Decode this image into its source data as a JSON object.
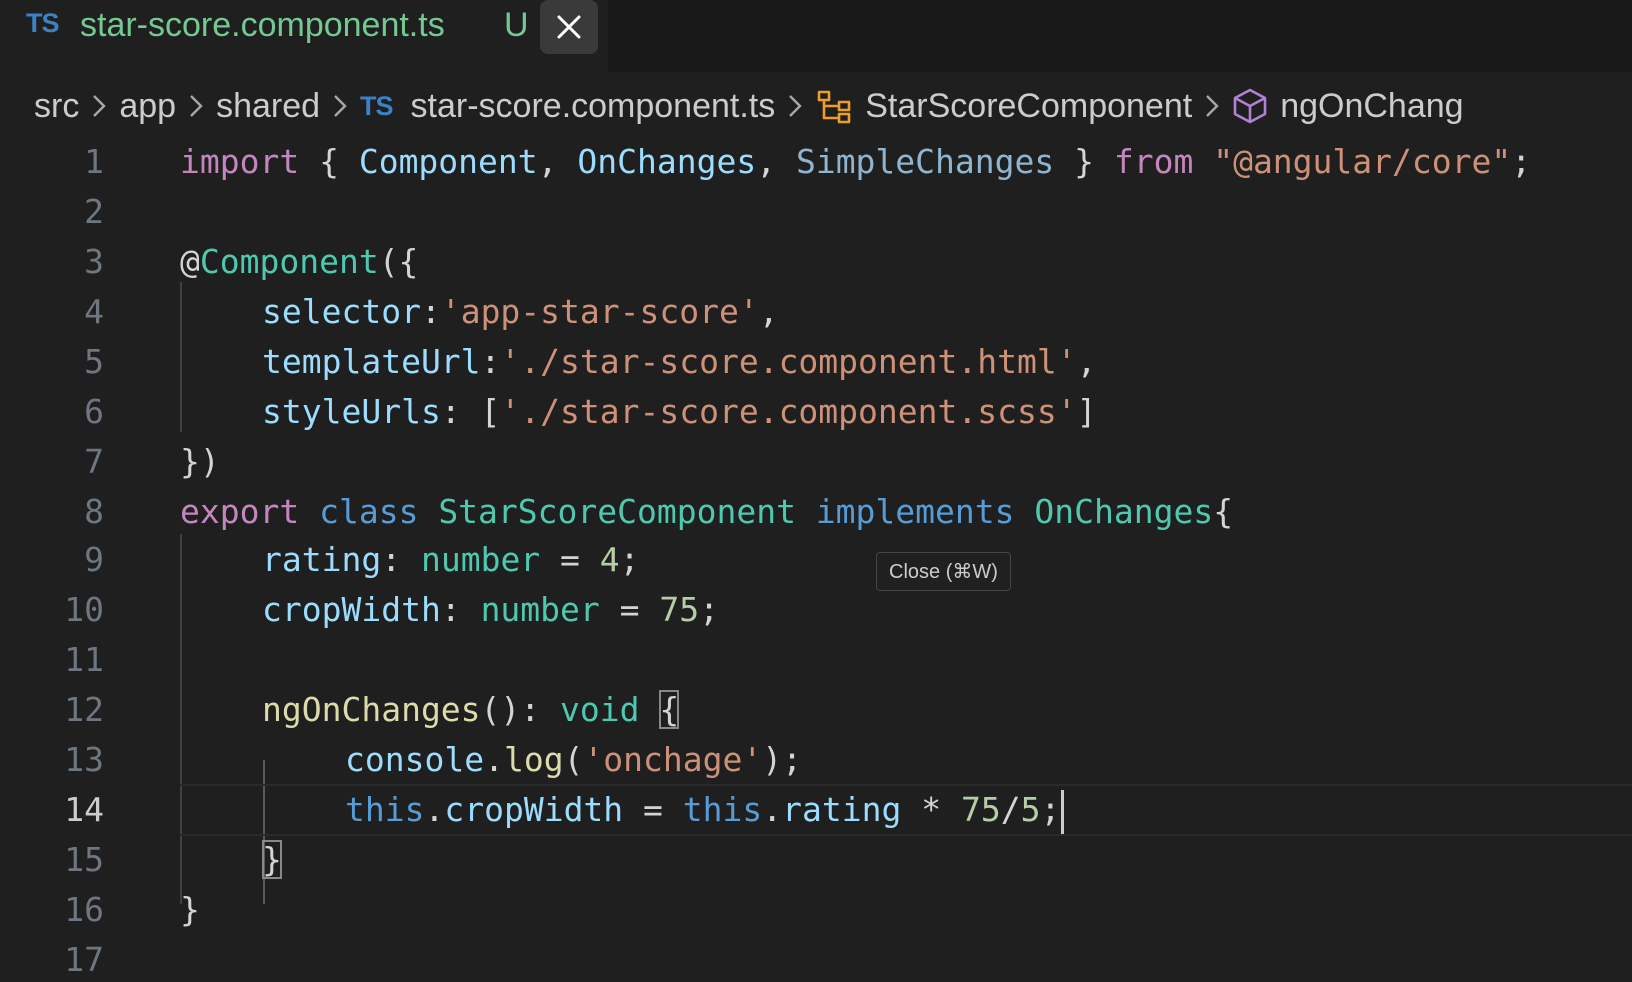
{
  "tab": {
    "badge": "TS",
    "title": "star-score.component.ts",
    "status": "U"
  },
  "tooltip": {
    "text": "Close (⌘W)"
  },
  "breadcrumb": {
    "src": "src",
    "app": "app",
    "shared": "shared",
    "file_badge": "TS",
    "file": "star-score.component.ts",
    "class": "StarScoreComponent",
    "method": "ngOnChang"
  },
  "editor": {
    "line_numbers": [
      "1",
      "2",
      "3",
      "4",
      "5",
      "6",
      "7",
      "8",
      "9",
      "10",
      "11",
      "12",
      "13",
      "14",
      "15",
      "16",
      "17"
    ],
    "active_line": "14",
    "code": {
      "l1": {
        "import": "import",
        "open": " { ",
        "component": "Component",
        "comma1": ", ",
        "onchanges": "OnChanges",
        "comma2": ", ",
        "simplechanges": "SimpleChanges",
        "close": " } ",
        "from": "from",
        "sp": " ",
        "module": "\"@angular/core\"",
        "semi": ";"
      },
      "l3": {
        "at": "@",
        "name": "Component",
        "paren": "({"
      },
      "l4": {
        "key": "selector",
        "colon": ":",
        "value": "'app-star-score'",
        "comma": ","
      },
      "l5": {
        "key": "templateUrl",
        "colon": ":",
        "value": "'./star-score.component.html'",
        "comma": ","
      },
      "l6": {
        "key": "styleUrls",
        "colon": ": [",
        "value": "'./star-score.component.scss'",
        "close": "]"
      },
      "l7": {
        "text": "})"
      },
      "l8": {
        "export": "export",
        "sp1": " ",
        "class": "class",
        "sp2": " ",
        "name": "StarScoreComponent",
        "sp3": " ",
        "implements": "implements",
        "sp4": " ",
        "iface": "OnChanges",
        "brace": "{"
      },
      "l9": {
        "prop": "rating",
        "colon": ": ",
        "type": "number",
        "eq": " = ",
        "value": "4",
        "semi": ";"
      },
      "l10": {
        "prop": "cropWidth",
        "colon": ": ",
        "type": "number",
        "eq": " = ",
        "value": "75",
        "semi": ";"
      },
      "l12": {
        "fn": "ngOnChanges",
        "paren": "(): ",
        "ret": "void",
        "sp": " ",
        "brace": "{"
      },
      "l13": {
        "obj": "console",
        "dot": ".",
        "fn": "log",
        "open": "(",
        "arg": "'onchage'",
        "close": ");"
      },
      "l14": {
        "this1": "this",
        "dot1": ".",
        "prop1": "cropWidth",
        "eq": " = ",
        "this2": "this",
        "dot2": ".",
        "prop2": "rating",
        "op": " * ",
        "n1": "75",
        "slash": "/",
        "n2": "5",
        "semi": ";"
      },
      "l15": {
        "brace": "}"
      },
      "l16": {
        "brace": "}"
      }
    }
  },
  "colors": {
    "background": "#1f1f1f",
    "tab_modified": "#73c991",
    "keyword": "#c586c0",
    "storage": "#569cd6",
    "type": "#4ec9b0",
    "variable": "#9cdcfe",
    "function": "#dcdcaa",
    "string": "#ce9178",
    "number": "#b5cea8"
  },
  "icons": {
    "tab_close": "close-icon",
    "breadcrumb_sep": "chevron-right-icon",
    "class": "symbol-class-icon",
    "method": "symbol-method-icon"
  }
}
